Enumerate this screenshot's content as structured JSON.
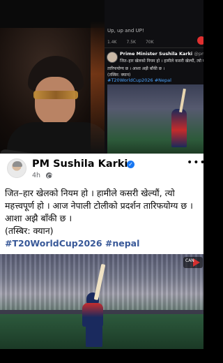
{
  "background_tweet": {
    "top_line": "Up, up and UP!",
    "actions": [
      "1.4K",
      "7.5K",
      "70K"
    ],
    "author": "Prime Minister Sushila Karki",
    "handle": "@pmsushilakarki",
    "text_line1": "जित–हार खेलको नियम हो । हामीले कसरी खेल्यौं, त्यो महत्त्वपूर्ण",
    "text_line2": "तारिफयोग्य छ । आशा अझै बाँकी छ ।",
    "text_line3": "(तस्बिर: क्यान)",
    "hashtags": "#T20WorldCup2026 #Nepal"
  },
  "post": {
    "page_name": "PM Sushila Karki",
    "time": "4h",
    "more_label": "•••",
    "lines": [
      "जित–हार खेलको नियम हो । हामीले कसरी खेल्यौं, त्यो",
      "महत्त्वपूर्ण हो । आज नेपाली टोलीको प्रदर्शन तारिफयोग्य छ ।",
      "आशा अझै बाँकी छ ।",
      "(तस्बिर: क्यान)"
    ],
    "hashtags": "#T20WorldCup2026 #nepal"
  },
  "photo": {
    "badge": "CAN"
  },
  "colors": {
    "verified": "#1877f2",
    "hashtag": "#385898",
    "secondary_text": "#65676b"
  }
}
